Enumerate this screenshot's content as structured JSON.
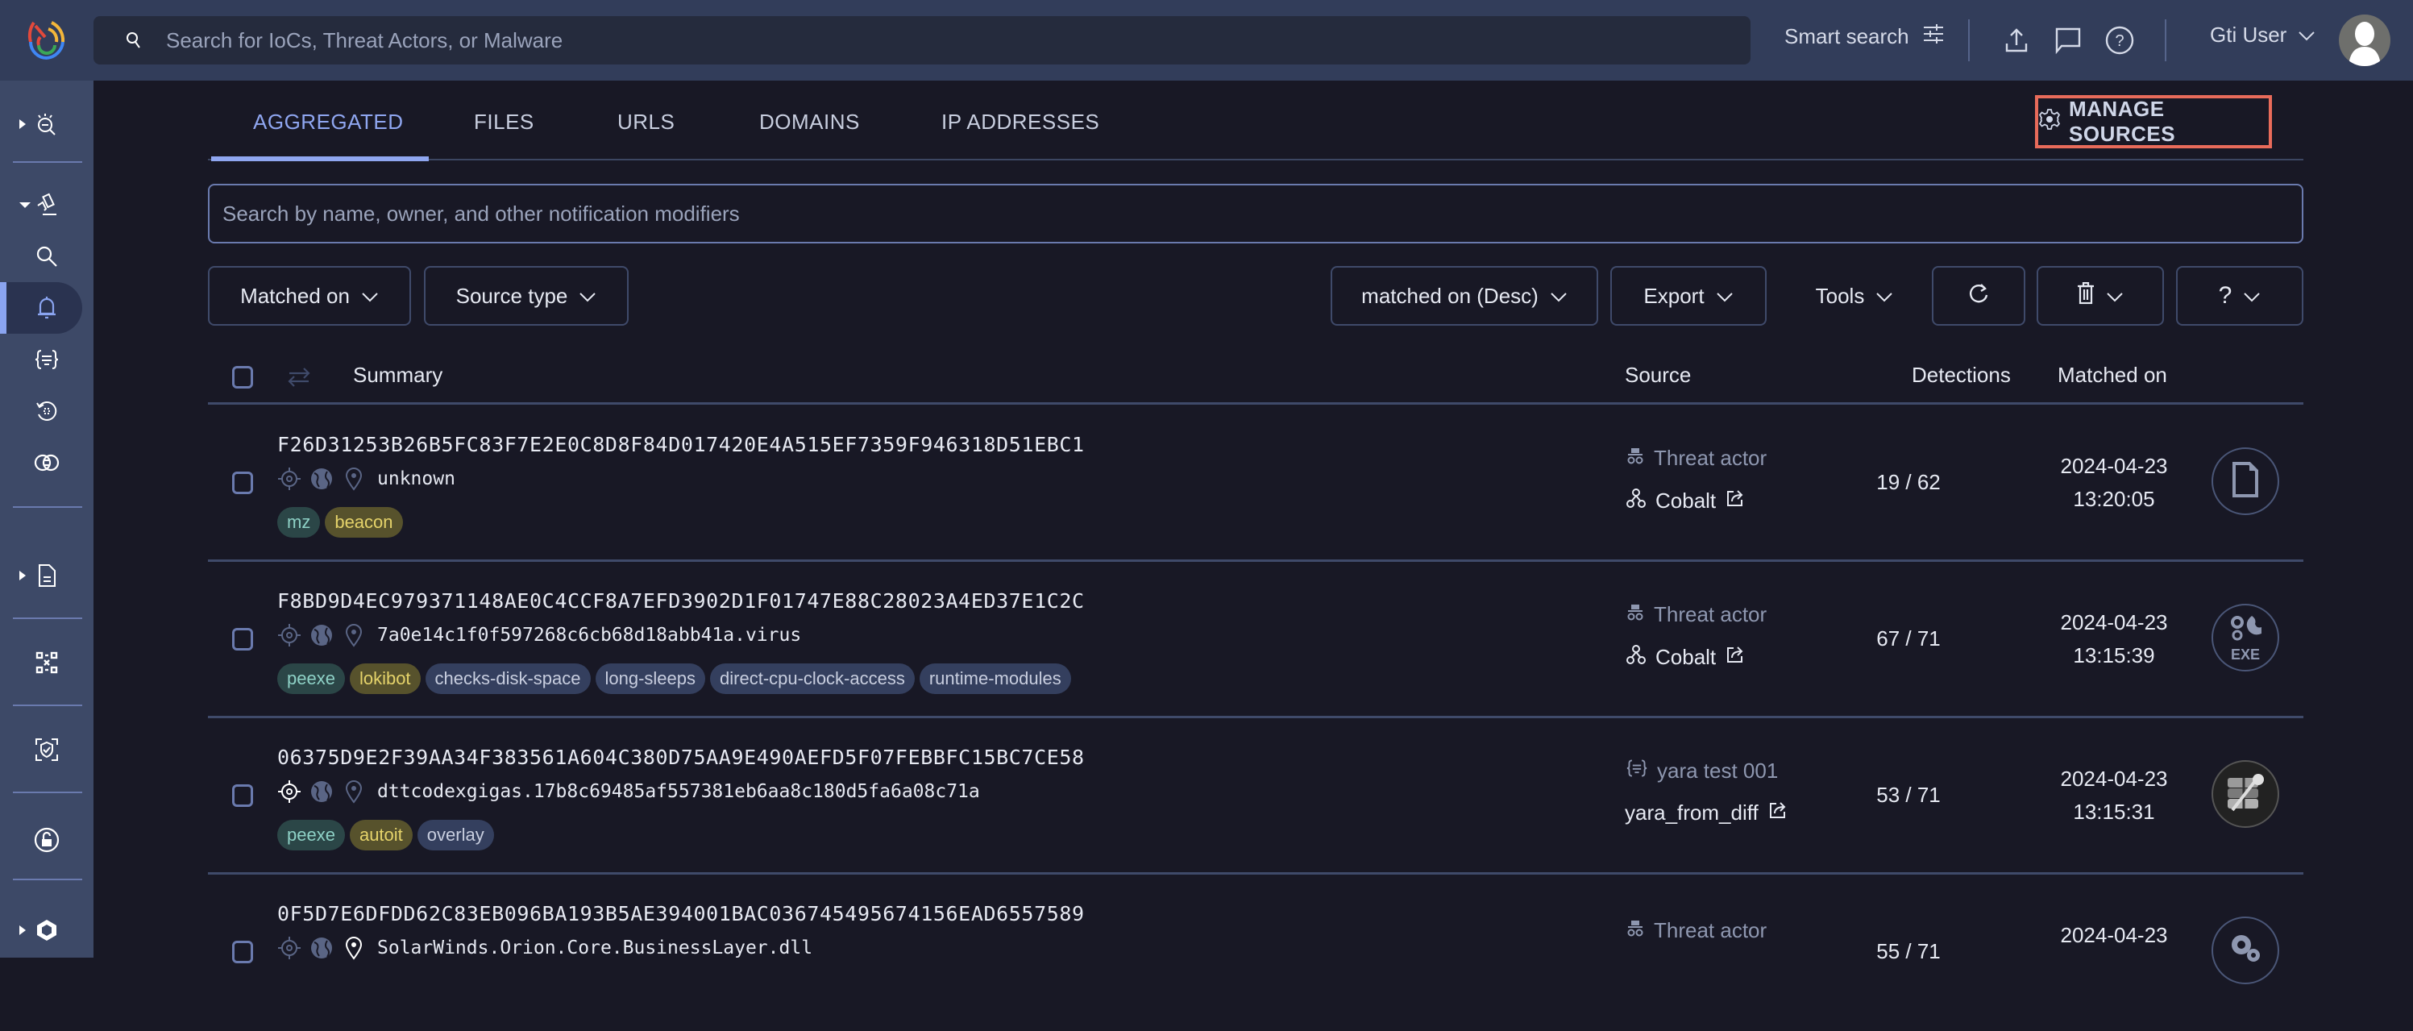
{
  "topbar": {
    "search_placeholder": "Search for IoCs, Threat Actors, or Malware",
    "smart_search_label": "Smart search",
    "user_name": "Gti User"
  },
  "sidebar": {
    "items": [
      {
        "icon": "threat-landscape-icon",
        "expandable": "collapsed"
      },
      {
        "icon": "hunting-icon",
        "expandable": "expanded"
      },
      {
        "icon": "search-icon"
      },
      {
        "icon": "bell-icon",
        "active": true
      },
      {
        "icon": "yara-rules-icon"
      },
      {
        "icon": "retrohunt-icon"
      },
      {
        "icon": "diff-icon"
      },
      {
        "icon": "report-icon",
        "expandable": "collapsed"
      },
      {
        "icon": "graph-icon"
      },
      {
        "icon": "shield-scan-icon"
      },
      {
        "icon": "unlock-icon"
      },
      {
        "icon": "hexagon-icon",
        "expandable": "collapsed"
      }
    ]
  },
  "tabs": [
    {
      "label": "AGGREGATED",
      "active": true
    },
    {
      "label": "FILES"
    },
    {
      "label": "URLS"
    },
    {
      "label": "DOMAINS"
    },
    {
      "label": "IP ADDRESSES"
    }
  ],
  "manage_sources_label": "MANAGE SOURCES",
  "filter_search_placeholder": "Search by name, owner, and other notification modifiers",
  "toolbar": {
    "matched_on": "Matched on",
    "source_type": "Source type",
    "sort": "matched on (Desc)",
    "export": "Export",
    "tools": "Tools"
  },
  "table": {
    "headers": {
      "summary": "Summary",
      "source": "Source",
      "detections": "Detections",
      "matched_on": "Matched on"
    },
    "rows": [
      {
        "hash": "F26D31253B26B5FC83F7E2E0C8D8F84D017420E4A515EF7359F946318D51EBC1",
        "name": "unknown",
        "tags": [
          {
            "label": "mz",
            "color": "teal"
          },
          {
            "label": "beacon",
            "color": "olive"
          }
        ],
        "source_type": "Threat actor",
        "source_type_icon": "spy-icon",
        "source_name": "Cobalt",
        "source_name_icon": "actor-icon",
        "detections": "19 / 62",
        "date": "2024-04-23",
        "time": "13:20:05",
        "file_type": "file-icon",
        "seen_highlight": false
      },
      {
        "hash": "F8BD9D4EC979371148AE0C4CCF8A7EFD3902D1F01747E88C28023A4ED37E1C2C",
        "name": "7a0e14c1f0f597268c6cb68d18abb41a.virus",
        "tags": [
          {
            "label": "peexe",
            "color": "teal"
          },
          {
            "label": "lokibot",
            "color": "olive"
          },
          {
            "label": "checks-disk-space",
            "color": "slate"
          },
          {
            "label": "long-sleeps",
            "color": "slate"
          },
          {
            "label": "direct-cpu-clock-access",
            "color": "slate"
          },
          {
            "label": "runtime-modules",
            "color": "slate"
          }
        ],
        "source_type": "Threat actor",
        "source_type_icon": "spy-icon",
        "source_name": "Cobalt",
        "source_name_icon": "actor-icon",
        "detections": "67 / 71",
        "date": "2024-04-23",
        "time": "13:15:39",
        "file_type": "exe-icon",
        "file_type_label": "EXE",
        "seen_highlight": false
      },
      {
        "hash": "06375D9E2F39AA34F383561A604C380D75AA9E490AEFD5F07FEBBFC15BC7CE58",
        "name": "dttcodexgigas.17b8c69485af557381eb6aa8c180d5fa6a08c71a",
        "tags": [
          {
            "label": "peexe",
            "color": "teal"
          },
          {
            "label": "autoit",
            "color": "olive"
          },
          {
            "label": "overlay",
            "color": "slate"
          }
        ],
        "source_type": "yara test 001",
        "source_type_icon": "yara-rules-icon",
        "source_name": "yara_from_diff",
        "source_name_icon": "",
        "detections": "53 / 71",
        "date": "2024-04-23",
        "time": "13:15:31",
        "file_type": "archive-app-icon",
        "seen_highlight": true
      },
      {
        "hash": "0F5D7E6DFDD62C83EB096BA193B5AE394001BAC036745495674156EAD6557589",
        "name": "SolarWinds.Orion.Core.BusinessLayer.dll",
        "tags": [],
        "source_type": "Threat actor",
        "source_type_icon": "spy-icon",
        "source_name": "",
        "source_name_icon": "",
        "detections": "55 / 71",
        "date": "2024-04-23",
        "time": "",
        "file_type": "dll-gears-icon",
        "seen_highlight": false
      }
    ]
  },
  "colors": {
    "accent": "#8fa6f0",
    "highlight_border": "#e86b5a",
    "topbar_bg": "#323d5a",
    "sidebar_bg": "#3d4967",
    "main_bg": "#181825"
  }
}
